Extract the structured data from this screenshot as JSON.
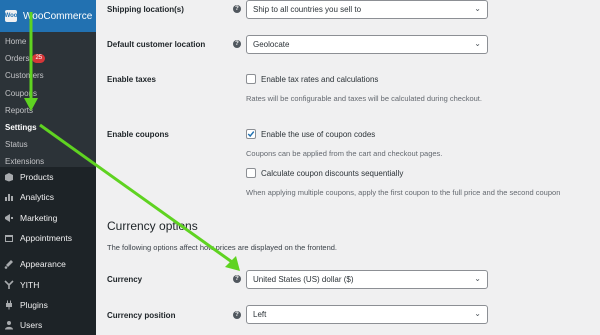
{
  "sidebar": {
    "header": {
      "title": "WooCommerce",
      "logo_text": "Woo"
    },
    "subitems": [
      {
        "label": "Home"
      },
      {
        "label": "Orders",
        "badge": "25"
      },
      {
        "label": "Customers"
      },
      {
        "label": "Coupons"
      },
      {
        "label": "Reports"
      },
      {
        "label": "Settings"
      },
      {
        "label": "Status"
      },
      {
        "label": "Extensions"
      }
    ],
    "menu": [
      {
        "label": "Products",
        "icon": "box-icon"
      },
      {
        "label": "Analytics",
        "icon": "chart-icon"
      },
      {
        "label": "Marketing",
        "icon": "megaphone-icon"
      },
      {
        "label": "Appointments",
        "icon": "calendar-icon"
      },
      {
        "label": "Appearance",
        "icon": "brush-icon"
      },
      {
        "label": "YITH",
        "icon": "yith-icon"
      },
      {
        "label": "Plugins",
        "icon": "plugin-icon"
      },
      {
        "label": "Users",
        "icon": "user-icon"
      }
    ]
  },
  "settings": {
    "shipping_locations": {
      "label": "Shipping location(s)",
      "value": "Ship to all countries you sell to"
    },
    "default_customer_location": {
      "label": "Default customer location",
      "value": "Geolocate"
    },
    "enable_taxes": {
      "label": "Enable taxes",
      "checkbox_label": "Enable tax rates and calculations",
      "checked": false,
      "desc": "Rates will be configurable and taxes will be calculated during checkout."
    },
    "enable_coupons": {
      "label": "Enable coupons",
      "checkbox_label": "Enable the use of coupon codes",
      "checked": true,
      "desc": "Coupons can be applied from the cart and checkout pages.",
      "seq_label": "Calculate coupon discounts sequentially",
      "seq_checked": false,
      "seq_desc": "When applying multiple coupons, apply the first coupon to the full price and the second coupon"
    }
  },
  "currency_options": {
    "title": "Currency options",
    "desc": "The following options affect how prices are displayed on the frontend.",
    "currency": {
      "label": "Currency",
      "value": "United States (US) dollar ($)"
    },
    "currency_position": {
      "label": "Currency position",
      "value": "Left"
    }
  },
  "help_symbol": "?",
  "chevron": "⌄",
  "colors": {
    "accent": "#2271b1",
    "arrow": "#5fd321",
    "sidebar_bg": "#1d2327",
    "badge": "#d63638"
  }
}
